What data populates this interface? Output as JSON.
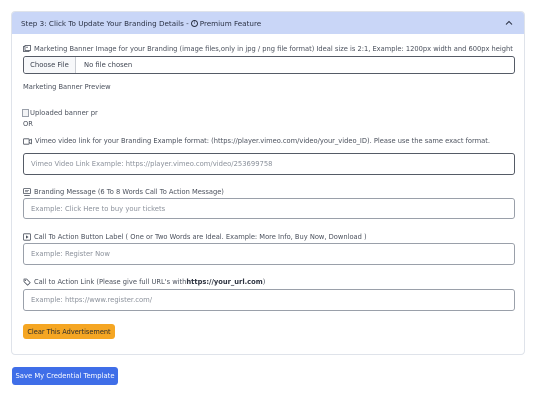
{
  "section": {
    "header_text": "Step 3: Click To Update Your Branding Details -",
    "premium_label": "Premium Feature",
    "info_glyph": "i"
  },
  "banner": {
    "label": "Marketing Banner Image for your Branding (image files,only in jpg / png file format) Ideal size is 2:1, Example: 1200px width and 600px height",
    "choose_file": "Choose File",
    "no_file": "No file chosen",
    "preview_label": "Marketing Banner Preview",
    "preview_alt": "Uploaded banner pr"
  },
  "or_text": "OR",
  "vimeo": {
    "label": "Vimeo video link for your Branding Example format: (https://player.vimeo.com/video/your_video_ID). Please use the same exact format.",
    "placeholder": "Vimeo Video Link Example:                    https://player.vimeo.com/video/253699758"
  },
  "branding_message": {
    "label": "Branding Message (6 To 8 Words Call To Action Message)",
    "placeholder": "Example: Click Here to buy your tickets"
  },
  "cta_label": {
    "label": "Call To Action Button Label ( One or Two Words are Ideal. Example: More Info, Buy Now, Download )",
    "placeholder": "Example: Register Now"
  },
  "cta_link": {
    "label_prefix": "Call to Action Link (Please give full URL's with ",
    "label_bold": "https://your_url.com",
    "label_suffix": ")",
    "placeholder": "Example: https://www.register.com/"
  },
  "clear_button": "Clear This Advertisement",
  "save_button": "Save My Credential Template",
  "colors": {
    "header_bg": "#c9d6f7",
    "clear_button": "#f5a623",
    "save_button": "#3f6ee8"
  },
  "icons": [
    "info-icon",
    "chevron-up-icon",
    "images-icon",
    "video-icon",
    "message-icon",
    "play-icon",
    "link-icon",
    "broken-image-icon"
  ]
}
